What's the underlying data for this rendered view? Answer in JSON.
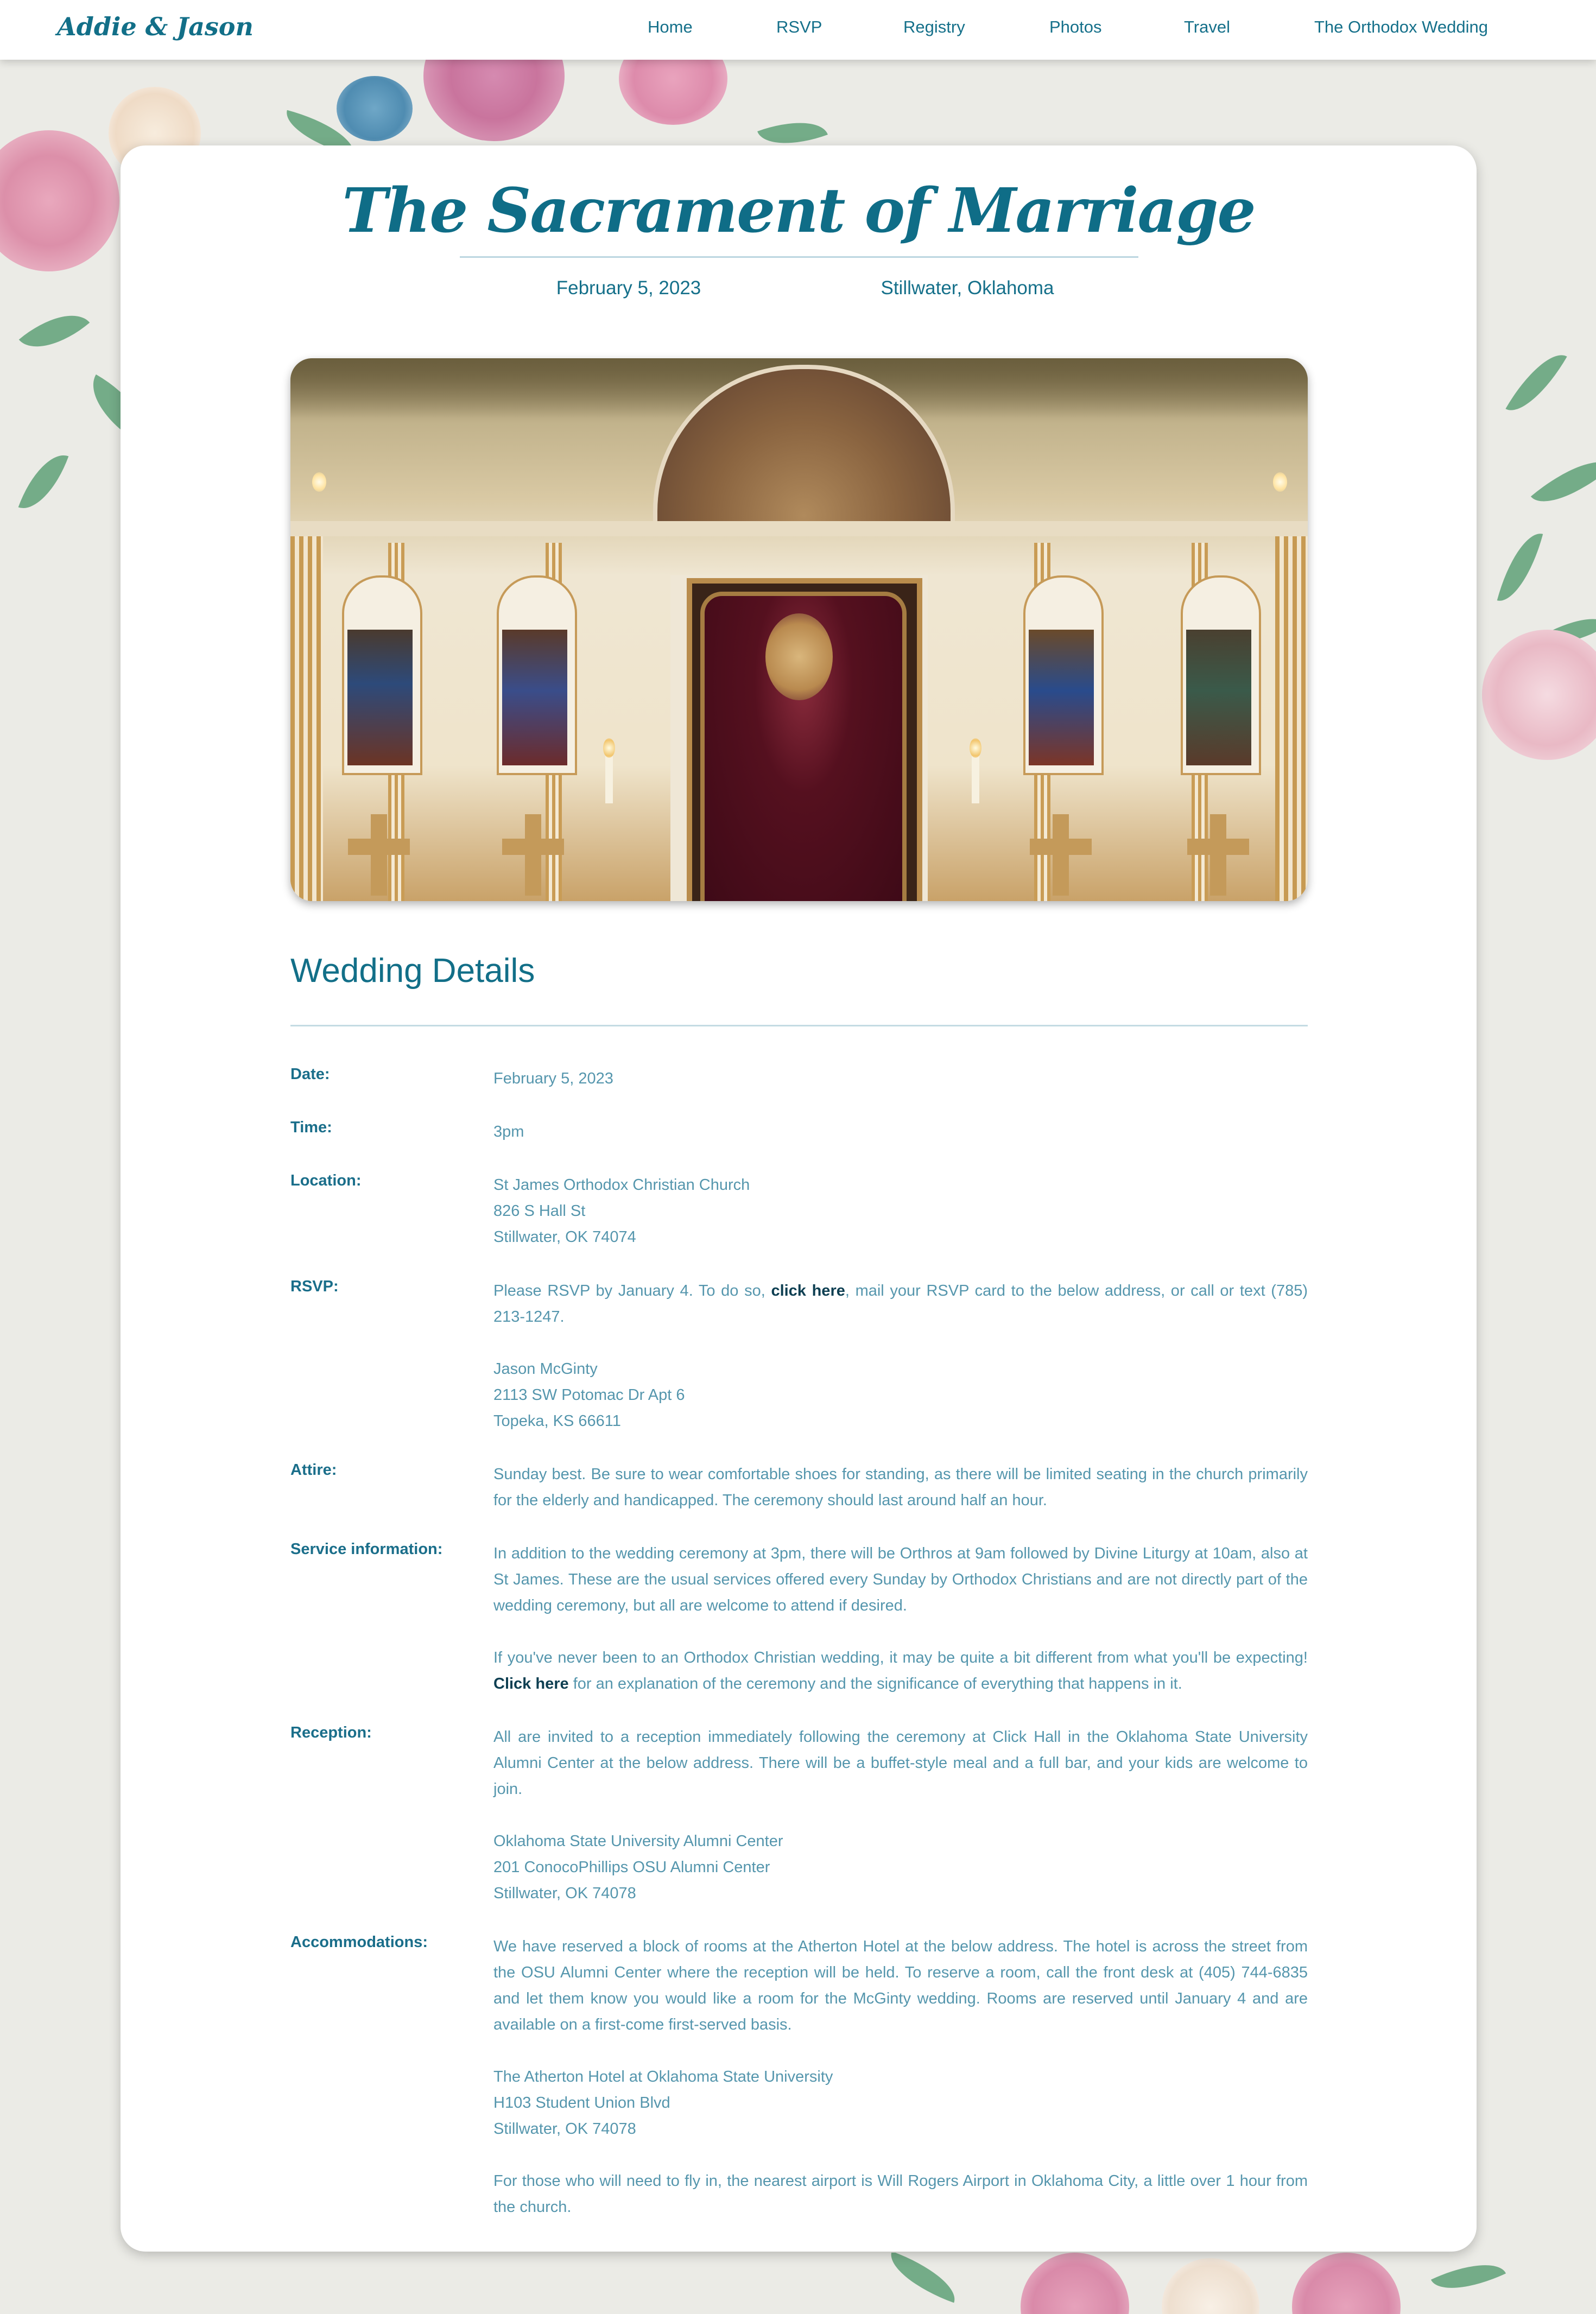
{
  "nav": {
    "brand": "Addie & Jason",
    "items": [
      "Home",
      "RSVP",
      "Registry",
      "Photos",
      "Travel",
      "The Orthodox Wedding"
    ]
  },
  "header": {
    "title": "The Sacrament of Marriage",
    "date": "February 5, 2023",
    "location": "Stillwater, Oklahoma"
  },
  "details": {
    "heading": "Wedding Details",
    "date": {
      "label": "Date:",
      "value": "February 5, 2023"
    },
    "time": {
      "label": "Time:",
      "value": "3pm"
    },
    "location": {
      "label": "Location:",
      "lines": [
        "St James Orthodox Christian Church",
        "826 S Hall St",
        "Stillwater, OK 74074"
      ]
    },
    "rsvp": {
      "label": "RSVP:",
      "before_link": "Please RSVP by January 4. To do so, ",
      "link": "click here",
      "after_link": ", mail your RSVP card to the below address, or call or text (785) 213-1247.",
      "address": [
        "Jason McGinty",
        "2113 SW Potomac Dr Apt 6",
        "Topeka, KS 66611"
      ]
    },
    "attire": {
      "label": "Attire:",
      "text": "Sunday best. Be sure to wear comfortable shoes for standing, as there will be limited seating in the church primarily for the elderly and handicapped. The ceremony should last around half an hour."
    },
    "service": {
      "label": "Service information:",
      "text": "In addition to the wedding ceremony at 3pm, there will be Orthros at 9am followed by Divine Liturgy at 10am, also at St James. These are the usual services offered every Sunday by Orthodox Christians and are not directly part of the wedding ceremony, but all are welcome to attend if desired.",
      "before_link": "If you've never been to an Orthodox Christian wedding, it may be quite a bit different from what you'll be expecting! ",
      "link": "Click here",
      "after_link": " for an explanation of the ceremony and the significance of everything that happens in it."
    },
    "reception": {
      "label": "Reception:",
      "text": "All are invited to a reception immediately following the ceremony at Click Hall in the Oklahoma State University Alumni Center at the below address. There will be a buffet-style meal and a full bar, and your kids are welcome to join.",
      "address": [
        "Oklahoma State University Alumni Center",
        "201 ConocoPhillips OSU Alumni Center",
        "Stillwater, OK 74078"
      ]
    },
    "accommodations": {
      "label": "Accommodations:",
      "text": "We have reserved a block of rooms at the Atherton Hotel at the below address. The hotel is across the street from the OSU Alumni Center where the reception will be held. To reserve a room, call the front desk at (405) 744-6835 and let them know you would like a room for the McGinty wedding. Rooms are reserved until January 4 and are available on a first-come first-served basis.",
      "address": [
        "The Atherton Hotel at Oklahoma State University",
        "H103 Student Union Blvd",
        "Stillwater, OK 74078"
      ],
      "airport": "For those who will need to fly in, the nearest airport is Will Rogers Airport in Oklahoma City, a little over 1 hour from the church."
    }
  },
  "colors": {
    "accent": "#126f88",
    "body_text": "#5596ad",
    "link": "#0e3f52",
    "page_bg": "#ebebe6"
  }
}
